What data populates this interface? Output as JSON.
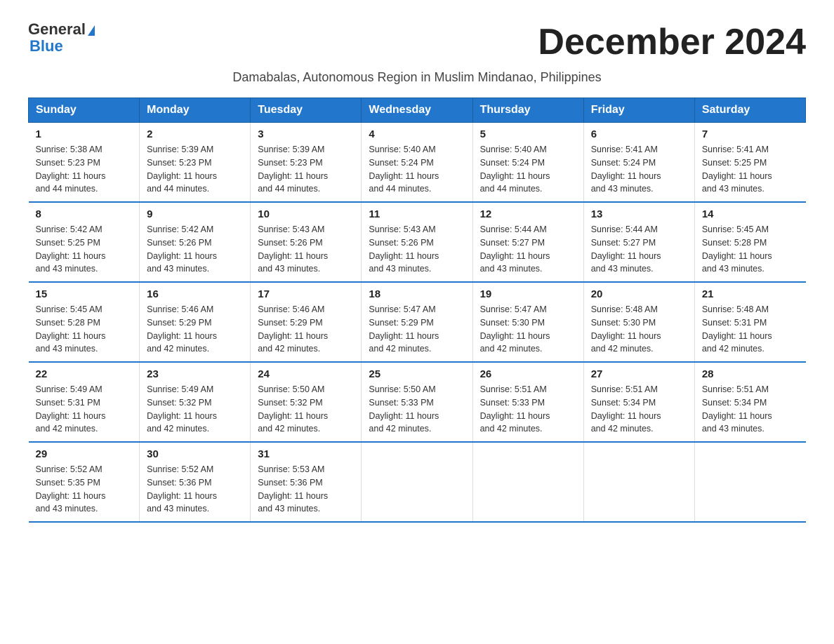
{
  "logo": {
    "text_general": "General",
    "triangle": "▶",
    "text_blue": "Blue"
  },
  "title": "December 2024",
  "subtitle": "Damabalas, Autonomous Region in Muslim Mindanao, Philippines",
  "headers": [
    "Sunday",
    "Monday",
    "Tuesday",
    "Wednesday",
    "Thursday",
    "Friday",
    "Saturday"
  ],
  "weeks": [
    [
      {
        "day": "1",
        "sunrise": "5:38 AM",
        "sunset": "5:23 PM",
        "daylight": "11 hours and 44 minutes."
      },
      {
        "day": "2",
        "sunrise": "5:39 AM",
        "sunset": "5:23 PM",
        "daylight": "11 hours and 44 minutes."
      },
      {
        "day": "3",
        "sunrise": "5:39 AM",
        "sunset": "5:23 PM",
        "daylight": "11 hours and 44 minutes."
      },
      {
        "day": "4",
        "sunrise": "5:40 AM",
        "sunset": "5:24 PM",
        "daylight": "11 hours and 44 minutes."
      },
      {
        "day": "5",
        "sunrise": "5:40 AM",
        "sunset": "5:24 PM",
        "daylight": "11 hours and 44 minutes."
      },
      {
        "day": "6",
        "sunrise": "5:41 AM",
        "sunset": "5:24 PM",
        "daylight": "11 hours and 43 minutes."
      },
      {
        "day": "7",
        "sunrise": "5:41 AM",
        "sunset": "5:25 PM",
        "daylight": "11 hours and 43 minutes."
      }
    ],
    [
      {
        "day": "8",
        "sunrise": "5:42 AM",
        "sunset": "5:25 PM",
        "daylight": "11 hours and 43 minutes."
      },
      {
        "day": "9",
        "sunrise": "5:42 AM",
        "sunset": "5:26 PM",
        "daylight": "11 hours and 43 minutes."
      },
      {
        "day": "10",
        "sunrise": "5:43 AM",
        "sunset": "5:26 PM",
        "daylight": "11 hours and 43 minutes."
      },
      {
        "day": "11",
        "sunrise": "5:43 AM",
        "sunset": "5:26 PM",
        "daylight": "11 hours and 43 minutes."
      },
      {
        "day": "12",
        "sunrise": "5:44 AM",
        "sunset": "5:27 PM",
        "daylight": "11 hours and 43 minutes."
      },
      {
        "day": "13",
        "sunrise": "5:44 AM",
        "sunset": "5:27 PM",
        "daylight": "11 hours and 43 minutes."
      },
      {
        "day": "14",
        "sunrise": "5:45 AM",
        "sunset": "5:28 PM",
        "daylight": "11 hours and 43 minutes."
      }
    ],
    [
      {
        "day": "15",
        "sunrise": "5:45 AM",
        "sunset": "5:28 PM",
        "daylight": "11 hours and 43 minutes."
      },
      {
        "day": "16",
        "sunrise": "5:46 AM",
        "sunset": "5:29 PM",
        "daylight": "11 hours and 42 minutes."
      },
      {
        "day": "17",
        "sunrise": "5:46 AM",
        "sunset": "5:29 PM",
        "daylight": "11 hours and 42 minutes."
      },
      {
        "day": "18",
        "sunrise": "5:47 AM",
        "sunset": "5:29 PM",
        "daylight": "11 hours and 42 minutes."
      },
      {
        "day": "19",
        "sunrise": "5:47 AM",
        "sunset": "5:30 PM",
        "daylight": "11 hours and 42 minutes."
      },
      {
        "day": "20",
        "sunrise": "5:48 AM",
        "sunset": "5:30 PM",
        "daylight": "11 hours and 42 minutes."
      },
      {
        "day": "21",
        "sunrise": "5:48 AM",
        "sunset": "5:31 PM",
        "daylight": "11 hours and 42 minutes."
      }
    ],
    [
      {
        "day": "22",
        "sunrise": "5:49 AM",
        "sunset": "5:31 PM",
        "daylight": "11 hours and 42 minutes."
      },
      {
        "day": "23",
        "sunrise": "5:49 AM",
        "sunset": "5:32 PM",
        "daylight": "11 hours and 42 minutes."
      },
      {
        "day": "24",
        "sunrise": "5:50 AM",
        "sunset": "5:32 PM",
        "daylight": "11 hours and 42 minutes."
      },
      {
        "day": "25",
        "sunrise": "5:50 AM",
        "sunset": "5:33 PM",
        "daylight": "11 hours and 42 minutes."
      },
      {
        "day": "26",
        "sunrise": "5:51 AM",
        "sunset": "5:33 PM",
        "daylight": "11 hours and 42 minutes."
      },
      {
        "day": "27",
        "sunrise": "5:51 AM",
        "sunset": "5:34 PM",
        "daylight": "11 hours and 42 minutes."
      },
      {
        "day": "28",
        "sunrise": "5:51 AM",
        "sunset": "5:34 PM",
        "daylight": "11 hours and 43 minutes."
      }
    ],
    [
      {
        "day": "29",
        "sunrise": "5:52 AM",
        "sunset": "5:35 PM",
        "daylight": "11 hours and 43 minutes."
      },
      {
        "day": "30",
        "sunrise": "5:52 AM",
        "sunset": "5:36 PM",
        "daylight": "11 hours and 43 minutes."
      },
      {
        "day": "31",
        "sunrise": "5:53 AM",
        "sunset": "5:36 PM",
        "daylight": "11 hours and 43 minutes."
      },
      null,
      null,
      null,
      null
    ]
  ],
  "labels": {
    "sunrise": "Sunrise:",
    "sunset": "Sunset:",
    "daylight": "Daylight:"
  }
}
